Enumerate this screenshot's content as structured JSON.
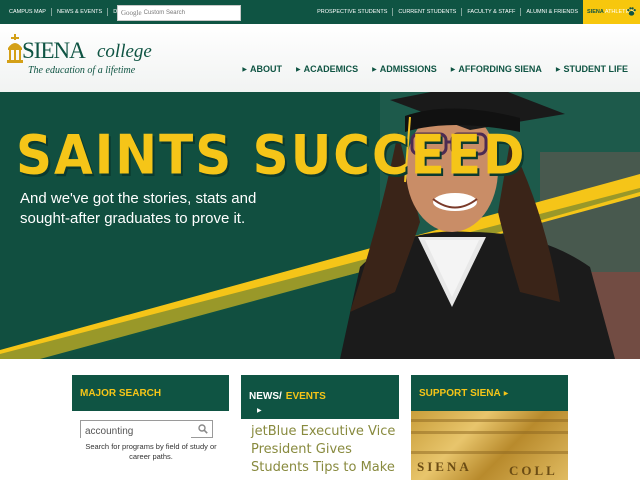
{
  "utility_nav": [
    "Campus Map",
    "News & Events",
    "Directory"
  ],
  "search": {
    "google_label": "Google",
    "placeholder": "Custom Search"
  },
  "audience_nav": [
    "Prospective Students",
    "Current Students",
    "Faculty & Staff",
    "Alumni & Friends"
  ],
  "athletics": {
    "part1": "SIENA",
    "part2": "ATHLETICS"
  },
  "logo": {
    "siena": "SIENA",
    "college": "college",
    "tagline": "The education of a lifetime"
  },
  "main_nav": [
    "ABOUT",
    "ACADEMICS",
    "ADMISSIONS",
    "AFFORDING SIENA",
    "STUDENT LIFE"
  ],
  "hero": {
    "title": "SAINTS SUCCEED",
    "subtitle": "And we've got the stories, stats and sought-after graduates to prove it."
  },
  "major_search": {
    "heading": "MAJOR SEARCH",
    "input_value": "accounting",
    "help": "Search for programs by field of study or career paths."
  },
  "news": {
    "news_label": "NEWS/",
    "events_label": "EVENTS",
    "arrow": "▶",
    "headline": "jetBlue Executive Vice President Gives Students Tips to Make"
  },
  "support": {
    "heading": "SUPPORT SIENA",
    "arrow": "▶",
    "plate_left": "SIENA",
    "plate_right": "COLL"
  },
  "colors": {
    "green": "#0f5443",
    "gold": "#f5c518",
    "yellow": "#f7c70d"
  },
  "icons": [
    "paw-icon",
    "search-icon",
    "siena-emblem-icon"
  ]
}
